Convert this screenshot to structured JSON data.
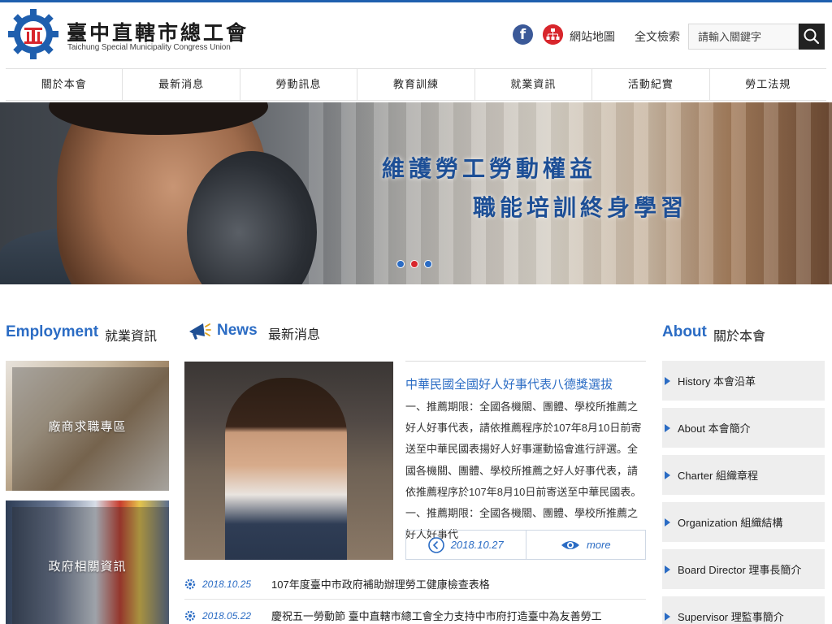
{
  "header": {
    "title": "臺中直轄市總工會",
    "subtitle": "Taichung Special Municipality Congress Union",
    "facebook_glyph": "f",
    "sitemap_label": "網站地圖",
    "search_label": "全文檢索",
    "search_placeholder": "請輸入關鍵字"
  },
  "nav": {
    "items": [
      {
        "label": "關於本會"
      },
      {
        "label": "最新消息"
      },
      {
        "label": "勞動訊息"
      },
      {
        "label": "教育訓練"
      },
      {
        "label": "就業資訊"
      },
      {
        "label": "活動紀實"
      },
      {
        "label": "勞工法規"
      }
    ]
  },
  "banner": {
    "slogan_line1": "維護勞工勞動權益",
    "slogan_line2": "職能培訓終身學習",
    "slide_count": 3,
    "active_slide": 2
  },
  "employment": {
    "title_en": "Employment",
    "title_zh": "就業資訊",
    "cards": [
      {
        "label": "廠商求職專區"
      },
      {
        "label": "政府相關資訊"
      }
    ]
  },
  "news": {
    "title_en": "News",
    "title_zh": "最新消息",
    "featured": {
      "title": "中華民國全國好人好事代表八德獎選拔",
      "body": "一、推薦期限：全國各機關、團體、學校所推薦之好人好事代表，請依推薦程序於107年8月10日前寄送至中華民國表揚好人好事運動協會進行評選。全國各機關、團體、學校所推薦之好人好事代表，請依推薦程序於107年8月10日前寄送至中華民國表。一、推薦期限：全國各機關、團體、學校所推薦之好人好事代",
      "date": "2018.10.27",
      "more_label": "more"
    },
    "items": [
      {
        "date": "2018.10.25",
        "title": "107年度臺中市政府補助辦理勞工健康檢查表格"
      },
      {
        "date": "2018.05.22",
        "title": "慶祝五一勞動節 臺中直轄市總工會全力支持中市府打造臺中為友善勞工"
      }
    ]
  },
  "about": {
    "title_en": "About",
    "title_zh": "關於本會",
    "items": [
      {
        "label": "History 本會沿革"
      },
      {
        "label": "About 本會簡介"
      },
      {
        "label": "Charter 組織章程"
      },
      {
        "label": "Organization 組織結構"
      },
      {
        "label": "Board Director 理事長簡介"
      },
      {
        "label": "Supervisor 理監事簡介"
      }
    ]
  },
  "colors": {
    "brand_blue": "#2b6cc4",
    "accent_red": "#d8262c",
    "facebook_blue": "#3b5998"
  }
}
